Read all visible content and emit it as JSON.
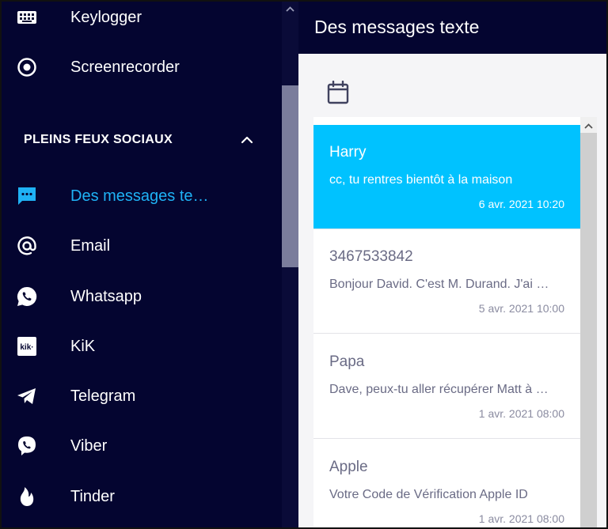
{
  "sidebar": {
    "items_top": [
      {
        "label": "Keylogger",
        "icon": "keyboard-icon"
      },
      {
        "label": "Screenrecorder",
        "icon": "record-icon"
      }
    ],
    "section": {
      "title": "PLEINS FEUX SOCIAUX",
      "icon": "chevron-up-icon"
    },
    "items_social": [
      {
        "label": "Des messages te…",
        "icon": "message-icon",
        "active": true
      },
      {
        "label": "Email",
        "icon": "at-icon"
      },
      {
        "label": "Whatsapp",
        "icon": "whatsapp-icon"
      },
      {
        "label": "KiK",
        "icon": "kik-icon"
      },
      {
        "label": "Telegram",
        "icon": "telegram-icon"
      },
      {
        "label": "Viber",
        "icon": "viber-icon"
      },
      {
        "label": "Tinder",
        "icon": "flame-icon"
      }
    ]
  },
  "main": {
    "title": "Des messages texte",
    "calendar_icon": "calendar-icon",
    "messages": [
      {
        "sender": "Harry",
        "preview": "cc, tu rentres bientôt à la maison",
        "date": "6 avr. 2021 10:20",
        "selected": true
      },
      {
        "sender": "3467533842",
        "preview": "Bonjour David. C'est M. Durand. J'ai …",
        "date": "5 avr. 2021 10:00",
        "selected": false
      },
      {
        "sender": "Papa",
        "preview": "Dave, peux-tu aller récupérer Matt à …",
        "date": "1 avr. 2021 08:00",
        "selected": false
      },
      {
        "sender": "Apple",
        "preview": "Votre Code de Vérification Apple ID",
        "date": "1 avr. 2021 08:00",
        "selected": false
      }
    ]
  },
  "colors": {
    "sidebar_bg": "#040530",
    "accent": "#1fb2f5",
    "selected_bg": "#00c2ff"
  }
}
